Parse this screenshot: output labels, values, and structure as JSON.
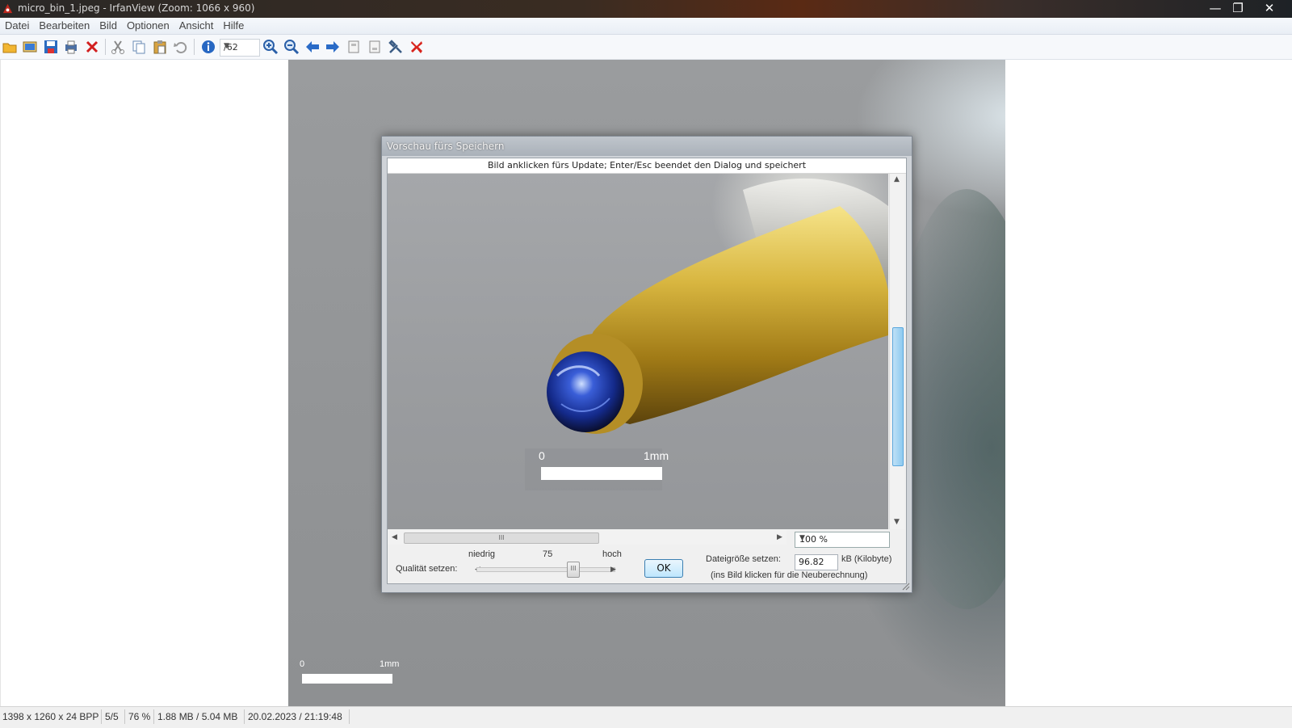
{
  "window": {
    "title": "micro_bin_1.jpeg - IrfanView (Zoom: 1066 x 960)",
    "controls": {
      "minimize": "—",
      "maximize": "❐",
      "close": "✕"
    }
  },
  "menu": [
    "Datei",
    "Bearbeiten",
    "Bild",
    "Optionen",
    "Ansicht",
    "Hilfe"
  ],
  "toolbar": {
    "zoom_value": "/62",
    "icons": [
      "open-folder-icon",
      "thumbnails-icon",
      "save-icon",
      "print-icon",
      "delete-icon",
      "cut-icon",
      "copy-icon",
      "paste-icon",
      "undo-icon",
      "info-icon",
      "zoom-in-icon",
      "zoom-out-icon",
      "previous-icon",
      "next-icon",
      "copy-to-icon",
      "move-to-icon",
      "settings-icon",
      "exit-icon"
    ]
  },
  "image_scale": {
    "left": "0",
    "right": "1mm"
  },
  "dialog": {
    "title": "Vorschau fürs Speichern",
    "hint": "Bild anklicken fürs Update; Enter/Esc beendet den Dialog und speichert",
    "preview_scale": {
      "left": "0",
      "right": "1mm"
    },
    "zoom_select": "100 %",
    "quality_label": "Qualität setzen:",
    "quality_low": "niedrig",
    "quality_value": "75",
    "quality_high": "hoch",
    "ok_label": "OK",
    "filesize_label": "Dateigröße setzen:",
    "filesize_value": "96.82",
    "filesize_unit": "kB (Kilobyte)",
    "filesize_note": "(ins Bild klicken für die Neuberechnung)"
  },
  "status": {
    "dimensions": "1398 x 1260 x 24 BPP",
    "index": "5/5",
    "zoom": "76 %",
    "size": "1.88 MB / 5.04 MB",
    "datetime": "20.02.2023 / 21:19:48"
  },
  "colors": {
    "accent": "#3c7fb1",
    "scroll_thumb": "#8ecaf0",
    "title_bar": "#2a2826"
  }
}
